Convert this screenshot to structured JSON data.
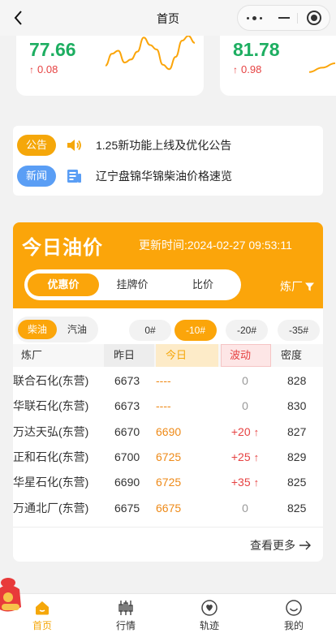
{
  "nav": {
    "title": "首页"
  },
  "cards": [
    {
      "value": "77.66",
      "change": "0.08",
      "trend": [
        0.28,
        0.55,
        0.62,
        0.35,
        0.42,
        0.6,
        0.92,
        0.75,
        0.65,
        0.3,
        0.2,
        0.48,
        0.85,
        0.96,
        0.8
      ]
    },
    {
      "value": "81.78",
      "change": "0.98",
      "trend": [
        0.2,
        0.35,
        0.5
      ]
    }
  ],
  "notices": [
    {
      "tag": "公告",
      "text": "1.25新功能上线及优化公告",
      "icon": "speaker-icon"
    },
    {
      "tag": "新闻",
      "text": "辽宁盘锦华锦柴油价格速览",
      "icon": "news-icon"
    }
  ],
  "oil": {
    "title": "今日油价",
    "update_time": "更新时间:2024-02-27 09:53:11",
    "tabs": [
      "优惠价",
      "挂牌价",
      "比价"
    ],
    "active_tab": 0,
    "refinery_filter": "炼厂",
    "fuel": [
      "柴油",
      "汽油"
    ],
    "active_fuel": 0,
    "grades": [
      "0#",
      "-10#",
      "-20#",
      "-35#"
    ],
    "active_grade": 1,
    "columns": [
      "炼厂",
      "昨日",
      "今日",
      "波动",
      "密度"
    ],
    "rows": [
      {
        "name": "联合石化(东营)",
        "yesterday": "6673",
        "today": "----",
        "wave": "0",
        "density": "828"
      },
      {
        "name": "华联石化(东营)",
        "yesterday": "6673",
        "today": "----",
        "wave": "0",
        "density": "830"
      },
      {
        "name": "万达天弘(东营)",
        "yesterday": "6670",
        "today": "6690",
        "wave": "+20",
        "density": "827"
      },
      {
        "name": "正和石化(东营)",
        "yesterday": "6700",
        "today": "6725",
        "wave": "+25",
        "density": "829"
      },
      {
        "name": "华星石化(东营)",
        "yesterday": "6690",
        "today": "6725",
        "wave": "+35",
        "density": "825"
      },
      {
        "name": "万通北厂(东营)",
        "yesterday": "6675",
        "today": "6675",
        "wave": "0",
        "density": "825"
      }
    ],
    "see_more": "查看更多"
  },
  "tabbar": [
    {
      "label": "首页",
      "icon": "home-icon"
    },
    {
      "label": "行情",
      "icon": "candlestick-icon"
    },
    {
      "label": "轨迹",
      "icon": "track-icon"
    },
    {
      "label": "我的",
      "icon": "profile-icon"
    }
  ],
  "active_tab_index": 0,
  "colors": {
    "accent": "#fba50a",
    "up": "#e64242",
    "green": "#1dae61",
    "blue": "#5a9ef5"
  }
}
